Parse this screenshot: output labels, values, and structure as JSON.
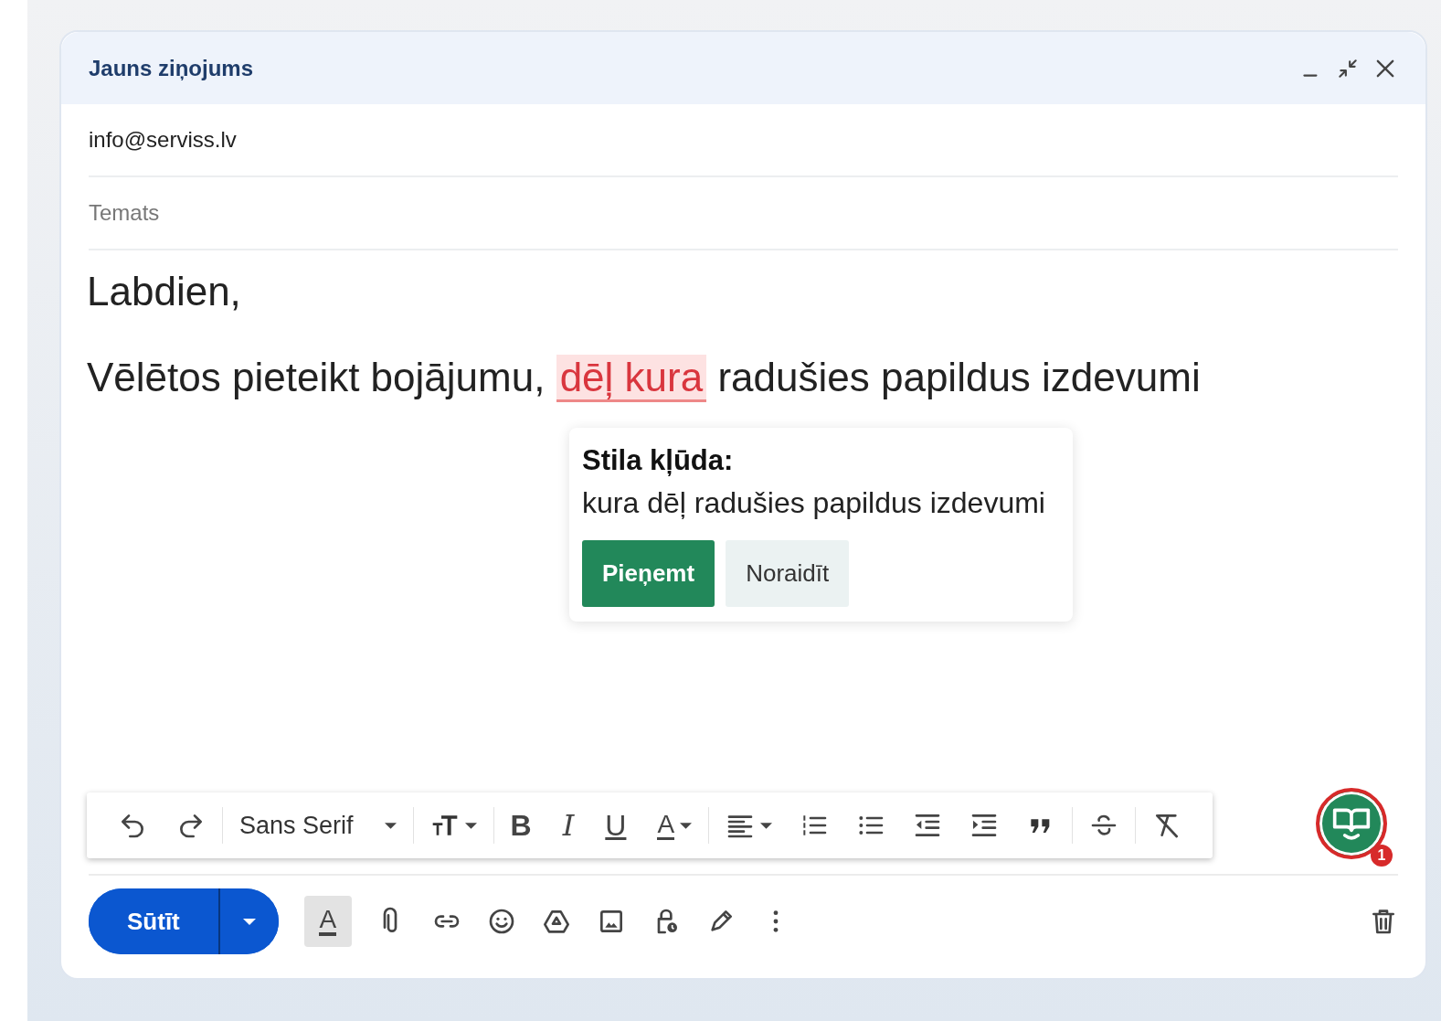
{
  "window": {
    "title": "Jauns ziņojums"
  },
  "to": {
    "value": "info@serviss.lv"
  },
  "subject": {
    "placeholder": "Temats"
  },
  "body": {
    "greeting": "Labdien,",
    "sentence": [
      {
        "text": "Vēlētos pieteikt bojājumu, ",
        "flagged": false
      },
      {
        "text": "dēļ kura",
        "flagged": true
      },
      {
        "text": " radušies papildus izdevumi",
        "flagged": false
      }
    ]
  },
  "suggestion": {
    "title": "Stila kļūda:",
    "text": "kura dēļ radušies papildus izdevumi",
    "buttons": [
      {
        "label": "Pieņemt",
        "kind": "primary"
      },
      {
        "label": "Noraidīt",
        "kind": "secondary"
      }
    ]
  },
  "toolbar": {
    "font": "Sans Serif",
    "bold": "B",
    "italic": "I",
    "underline": "U",
    "text_color": "A"
  },
  "checker": {
    "badge": "1"
  },
  "send": {
    "label": "Sūtīt"
  },
  "formatting": {
    "label": "A",
    "on": true
  }
}
